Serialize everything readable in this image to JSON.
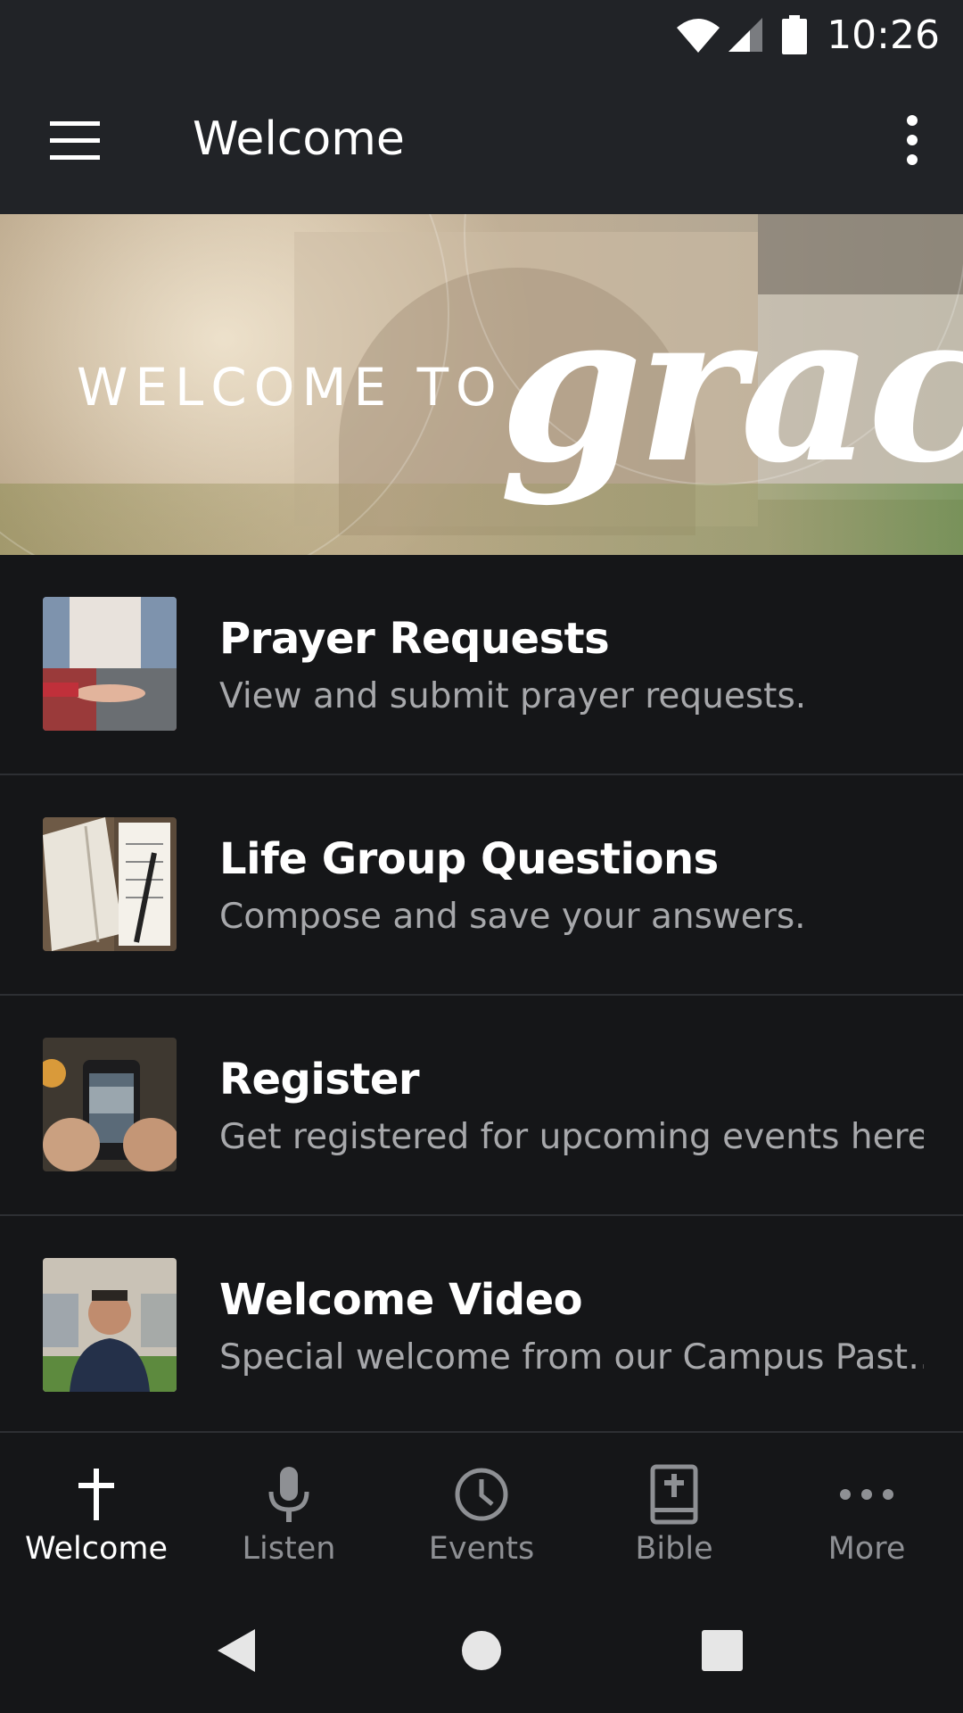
{
  "status_bar": {
    "time": "10:26",
    "icons": [
      "wifi-icon",
      "cell-signal-icon",
      "battery-icon"
    ]
  },
  "app_bar": {
    "title": "Welcome",
    "menu_icon": "hamburger-menu-icon",
    "overflow_icon": "more-vert-icon"
  },
  "banner": {
    "title": "WELCOME TO",
    "script": "grace"
  },
  "list": {
    "items": [
      {
        "title": "Prayer Requests",
        "subtitle": "View and submit prayer requests."
      },
      {
        "title": "Life Group Questions",
        "subtitle": "Compose and save your answers."
      },
      {
        "title": "Register",
        "subtitle": "Get registered for upcoming events here…"
      },
      {
        "title": "Welcome Video",
        "subtitle": "Special welcome from our Campus Past…"
      }
    ]
  },
  "tabs": [
    {
      "label": "Welcome",
      "icon": "cross-icon",
      "active": true
    },
    {
      "label": "Listen",
      "icon": "microphone-icon",
      "active": false
    },
    {
      "label": "Events",
      "icon": "clock-icon",
      "active": false
    },
    {
      "label": "Bible",
      "icon": "bible-icon",
      "active": false
    },
    {
      "label": "More",
      "icon": "more-horiz-icon",
      "active": false
    }
  ],
  "nav_bar": {
    "icons": [
      "back-icon",
      "home-icon",
      "recents-icon"
    ]
  },
  "colors": {
    "app_bar": "#212327",
    "background": "#151618",
    "subtitle": "#a7a8ab",
    "inactive_tab": "#8e9094",
    "active_tab": "#ffffff"
  }
}
